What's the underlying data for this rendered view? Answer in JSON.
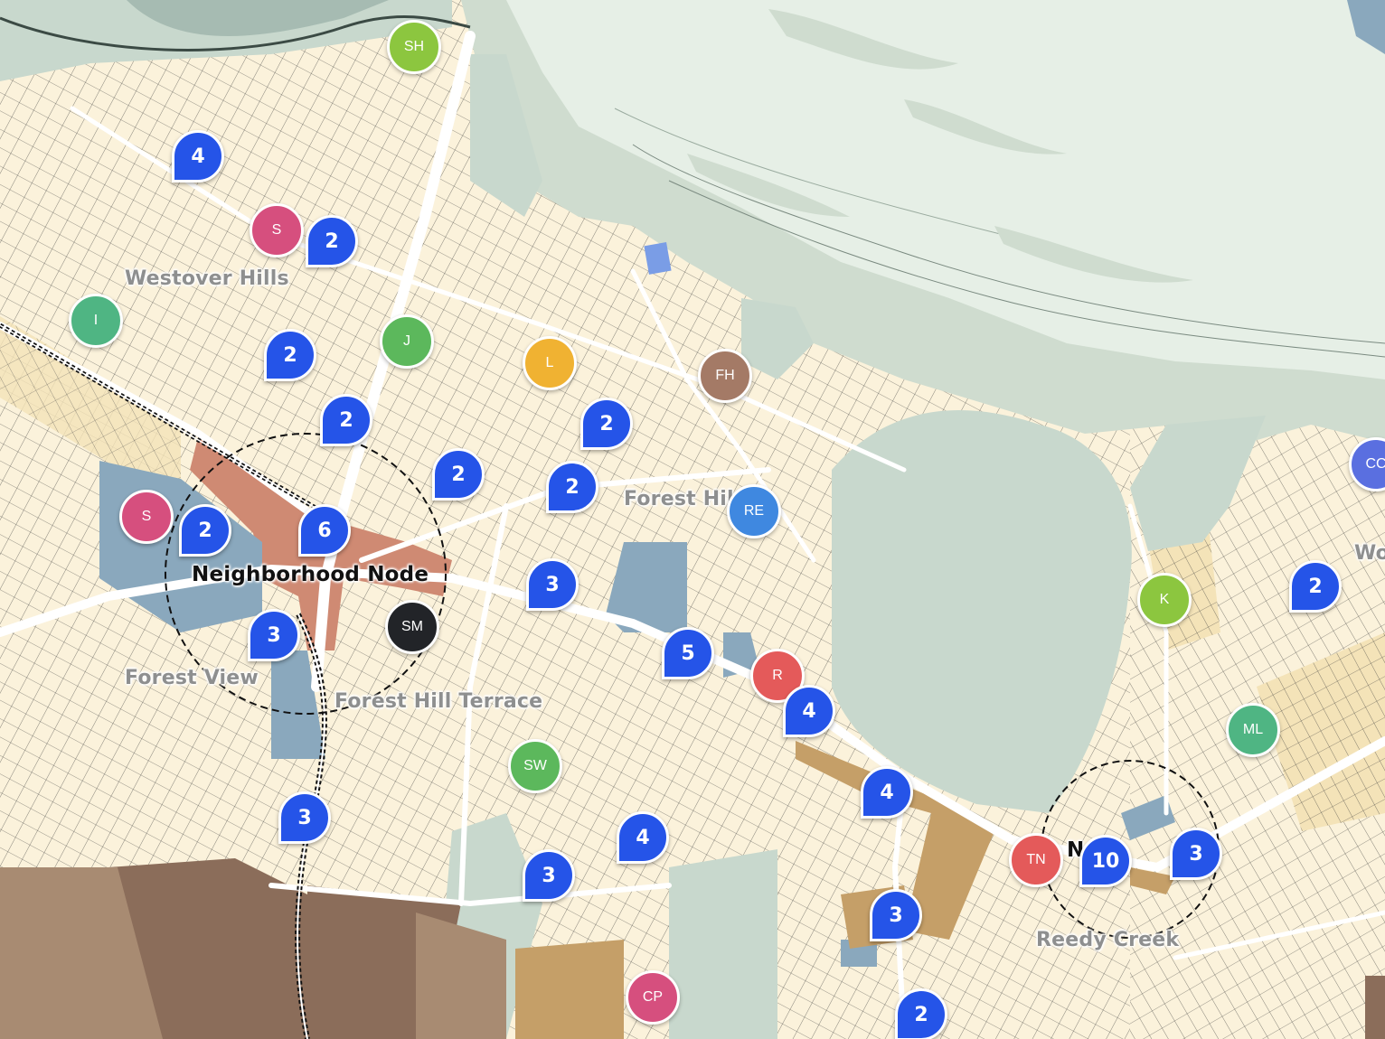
{
  "map": {
    "labels": {
      "westover_hills": "Westover Hills",
      "forest_hill": "Forest Hil",
      "neighborhood_node": "Neighborhood Node",
      "forest_view": "Forest View",
      "forest_hill_terrace": "Forest Hill Terrace",
      "reedy_creek": "Reedy Creek",
      "node_partial": "N    No",
      "wo_partial": "Wo"
    },
    "clusters": [
      {
        "id": "c1",
        "count": "4"
      },
      {
        "id": "c2",
        "count": "2"
      },
      {
        "id": "c3",
        "count": "2"
      },
      {
        "id": "c4",
        "count": "2"
      },
      {
        "id": "c5",
        "count": "2"
      },
      {
        "id": "c6",
        "count": "2"
      },
      {
        "id": "c7",
        "count": "2"
      },
      {
        "id": "c8",
        "count": "2"
      },
      {
        "id": "c9",
        "count": "6"
      },
      {
        "id": "c10",
        "count": "3"
      },
      {
        "id": "c11",
        "count": "3"
      },
      {
        "id": "c12",
        "count": "5"
      },
      {
        "id": "c13",
        "count": "4"
      },
      {
        "id": "c14",
        "count": "4"
      },
      {
        "id": "c15",
        "count": "3"
      },
      {
        "id": "c16",
        "count": "4"
      },
      {
        "id": "c17",
        "count": "3"
      },
      {
        "id": "c18",
        "count": "3"
      },
      {
        "id": "c19",
        "count": "10"
      },
      {
        "id": "c20",
        "count": "3"
      },
      {
        "id": "c21",
        "count": "2"
      },
      {
        "id": "c22",
        "count": "2"
      }
    ],
    "pois": [
      {
        "id": "p1",
        "label": "SH",
        "color": "#8cc63f"
      },
      {
        "id": "p2",
        "label": "S",
        "color": "#d64f7e"
      },
      {
        "id": "p3",
        "label": "I",
        "color": "#4fb583"
      },
      {
        "id": "p4",
        "label": "J",
        "color": "#5cb85c"
      },
      {
        "id": "p5",
        "label": "L",
        "color": "#f0b232"
      },
      {
        "id": "p6",
        "label": "FH",
        "color": "#a47a66"
      },
      {
        "id": "p7",
        "label": "S",
        "color": "#d64f7e"
      },
      {
        "id": "p8",
        "label": "RE",
        "color": "#3f88e0"
      },
      {
        "id": "p9",
        "label": "SM",
        "color": "#222428"
      },
      {
        "id": "p10",
        "label": "R",
        "color": "#e45a5a"
      },
      {
        "id": "p11",
        "label": "SW",
        "color": "#5cb85c"
      },
      {
        "id": "p12",
        "label": "K",
        "color": "#8cc63f"
      },
      {
        "id": "p13",
        "label": "ML",
        "color": "#4fb583"
      },
      {
        "id": "p14",
        "label": "TN",
        "color": "#e45a5a"
      },
      {
        "id": "p15",
        "label": "CP",
        "color": "#d64f7e"
      },
      {
        "id": "p16",
        "label": "CC",
        "color": "#5a6fe0"
      }
    ]
  }
}
